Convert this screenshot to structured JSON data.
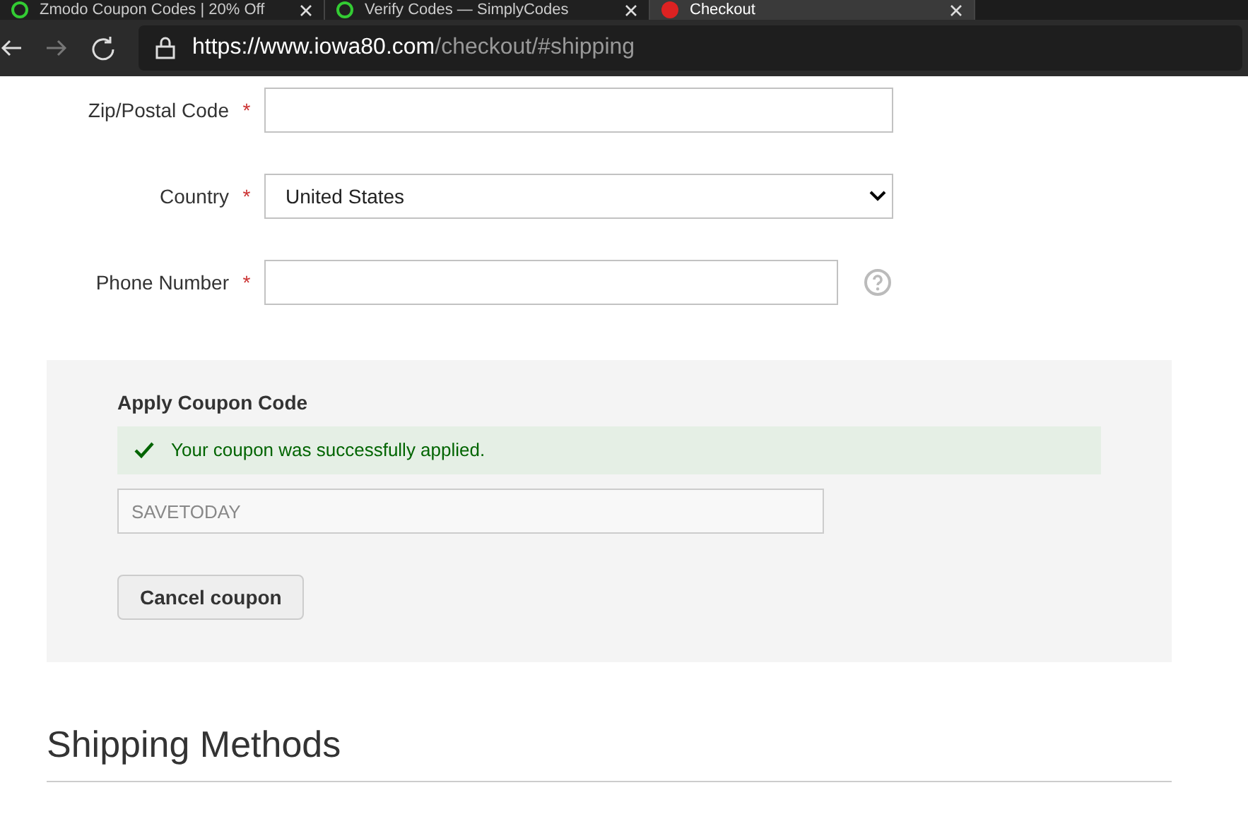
{
  "browser": {
    "tabs": [
      {
        "title": "Zmodo Coupon Codes | 20% Off",
        "selected": false
      },
      {
        "title": "Verify Codes — SimplyCodes",
        "selected": false
      },
      {
        "title": "Checkout",
        "selected": true
      }
    ],
    "url_host": "https://www.iowa80.com",
    "url_path": "/checkout/#shipping"
  },
  "form": {
    "fields": [
      {
        "kind": "text",
        "label": "Zip/Postal Code",
        "required_mark": "*"
      },
      {
        "kind": "select",
        "label": "Country",
        "required_mark": "*",
        "value": "United States"
      },
      {
        "kind": "text_help",
        "label": "Phone Number",
        "required_mark": "*"
      }
    ]
  },
  "coupon": {
    "title": "Apply Coupon Code",
    "message": "Your coupon was successfully applied.",
    "code": "SAVETODAY",
    "button": "Cancel coupon"
  },
  "shipping": {
    "title": "Shipping Methods"
  }
}
